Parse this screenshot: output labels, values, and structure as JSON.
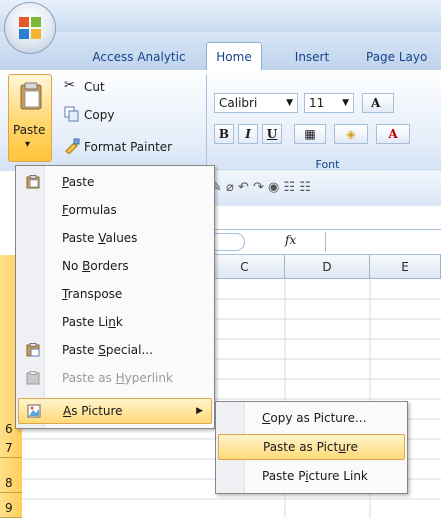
{
  "ribbon": {
    "tabs": [
      {
        "label": "Access Analytic"
      },
      {
        "label": "Home"
      },
      {
        "label": "Insert"
      },
      {
        "label": "Page Layo"
      }
    ],
    "clipboard": {
      "paste_label_1": "Paste",
      "paste_label_2": "▾",
      "cut_label": "Cut",
      "copy_label": "Copy",
      "format_painter_label": "Format Painter"
    },
    "font": {
      "font_name": "Calibri",
      "font_size": "11",
      "group_label": "Font",
      "bold": "B",
      "italic": "I",
      "underline": "U",
      "grow": "A",
      "color_a": "A"
    }
  },
  "formula_bar": {
    "fx_label": "fx"
  },
  "grid": {
    "columns": [
      "C",
      "D",
      "E"
    ],
    "rows": [
      "6",
      "7",
      "8",
      "9"
    ]
  },
  "paste_menu": {
    "items": [
      {
        "pre": "",
        "key": "P",
        "post": "aste",
        "disabled": false
      },
      {
        "pre": "",
        "key": "F",
        "post": "ormulas",
        "disabled": false
      },
      {
        "pre": "Paste ",
        "key": "V",
        "post": "alues",
        "disabled": false
      },
      {
        "pre": "No ",
        "key": "B",
        "post": "orders",
        "disabled": false
      },
      {
        "pre": "",
        "key": "T",
        "post": "ranspose",
        "disabled": false
      },
      {
        "pre": "Paste Li",
        "key": "n",
        "post": "k",
        "disabled": false
      },
      {
        "pre": "Paste ",
        "key": "S",
        "post": "pecial...",
        "disabled": false
      },
      {
        "pre": "Paste as ",
        "key": "H",
        "post": "yperlink",
        "disabled": true
      },
      {
        "pre": "",
        "key": "A",
        "post": "s Picture",
        "disabled": false
      }
    ]
  },
  "submenu": {
    "items": [
      {
        "pre": "",
        "key": "C",
        "post": "opy as Picture..."
      },
      {
        "pre": "Paste as Pict",
        "key": "u",
        "post": "re"
      },
      {
        "pre": "Paste P",
        "key": "i",
        "post": "cture Link"
      }
    ]
  },
  "colors": {
    "accent_text": "#15428b",
    "highlight": "#ffd978",
    "row_header": "#ffcf5a"
  }
}
